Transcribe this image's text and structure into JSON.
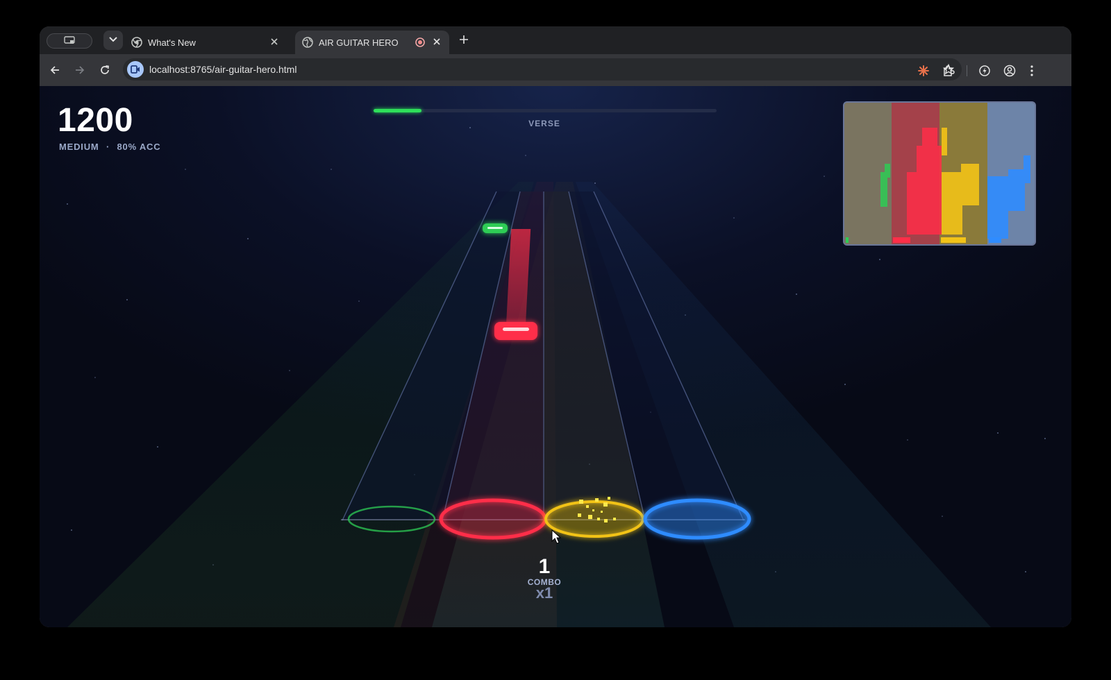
{
  "browser": {
    "tabs": [
      {
        "title": "What's New",
        "active": false
      },
      {
        "title": "AIR GUITAR HERO",
        "active": true,
        "recording": true
      }
    ],
    "url": "localhost:8765/air-guitar-hero.html"
  },
  "game": {
    "score": "1200",
    "difficulty": "MEDIUM",
    "separator": "·",
    "accuracy": "80% ACC",
    "song_progress": 0.14,
    "section": "VERSE",
    "combo": "1",
    "combo_label": "COMBO",
    "multiplier": "x1",
    "lane_colors": {
      "green": "#2ecc55",
      "red": "#ff2e48",
      "yellow": "#f2c318",
      "blue": "#2f8cff"
    },
    "camera_meters": [
      0.06,
      0.38,
      0.55,
      0.27
    ]
  }
}
